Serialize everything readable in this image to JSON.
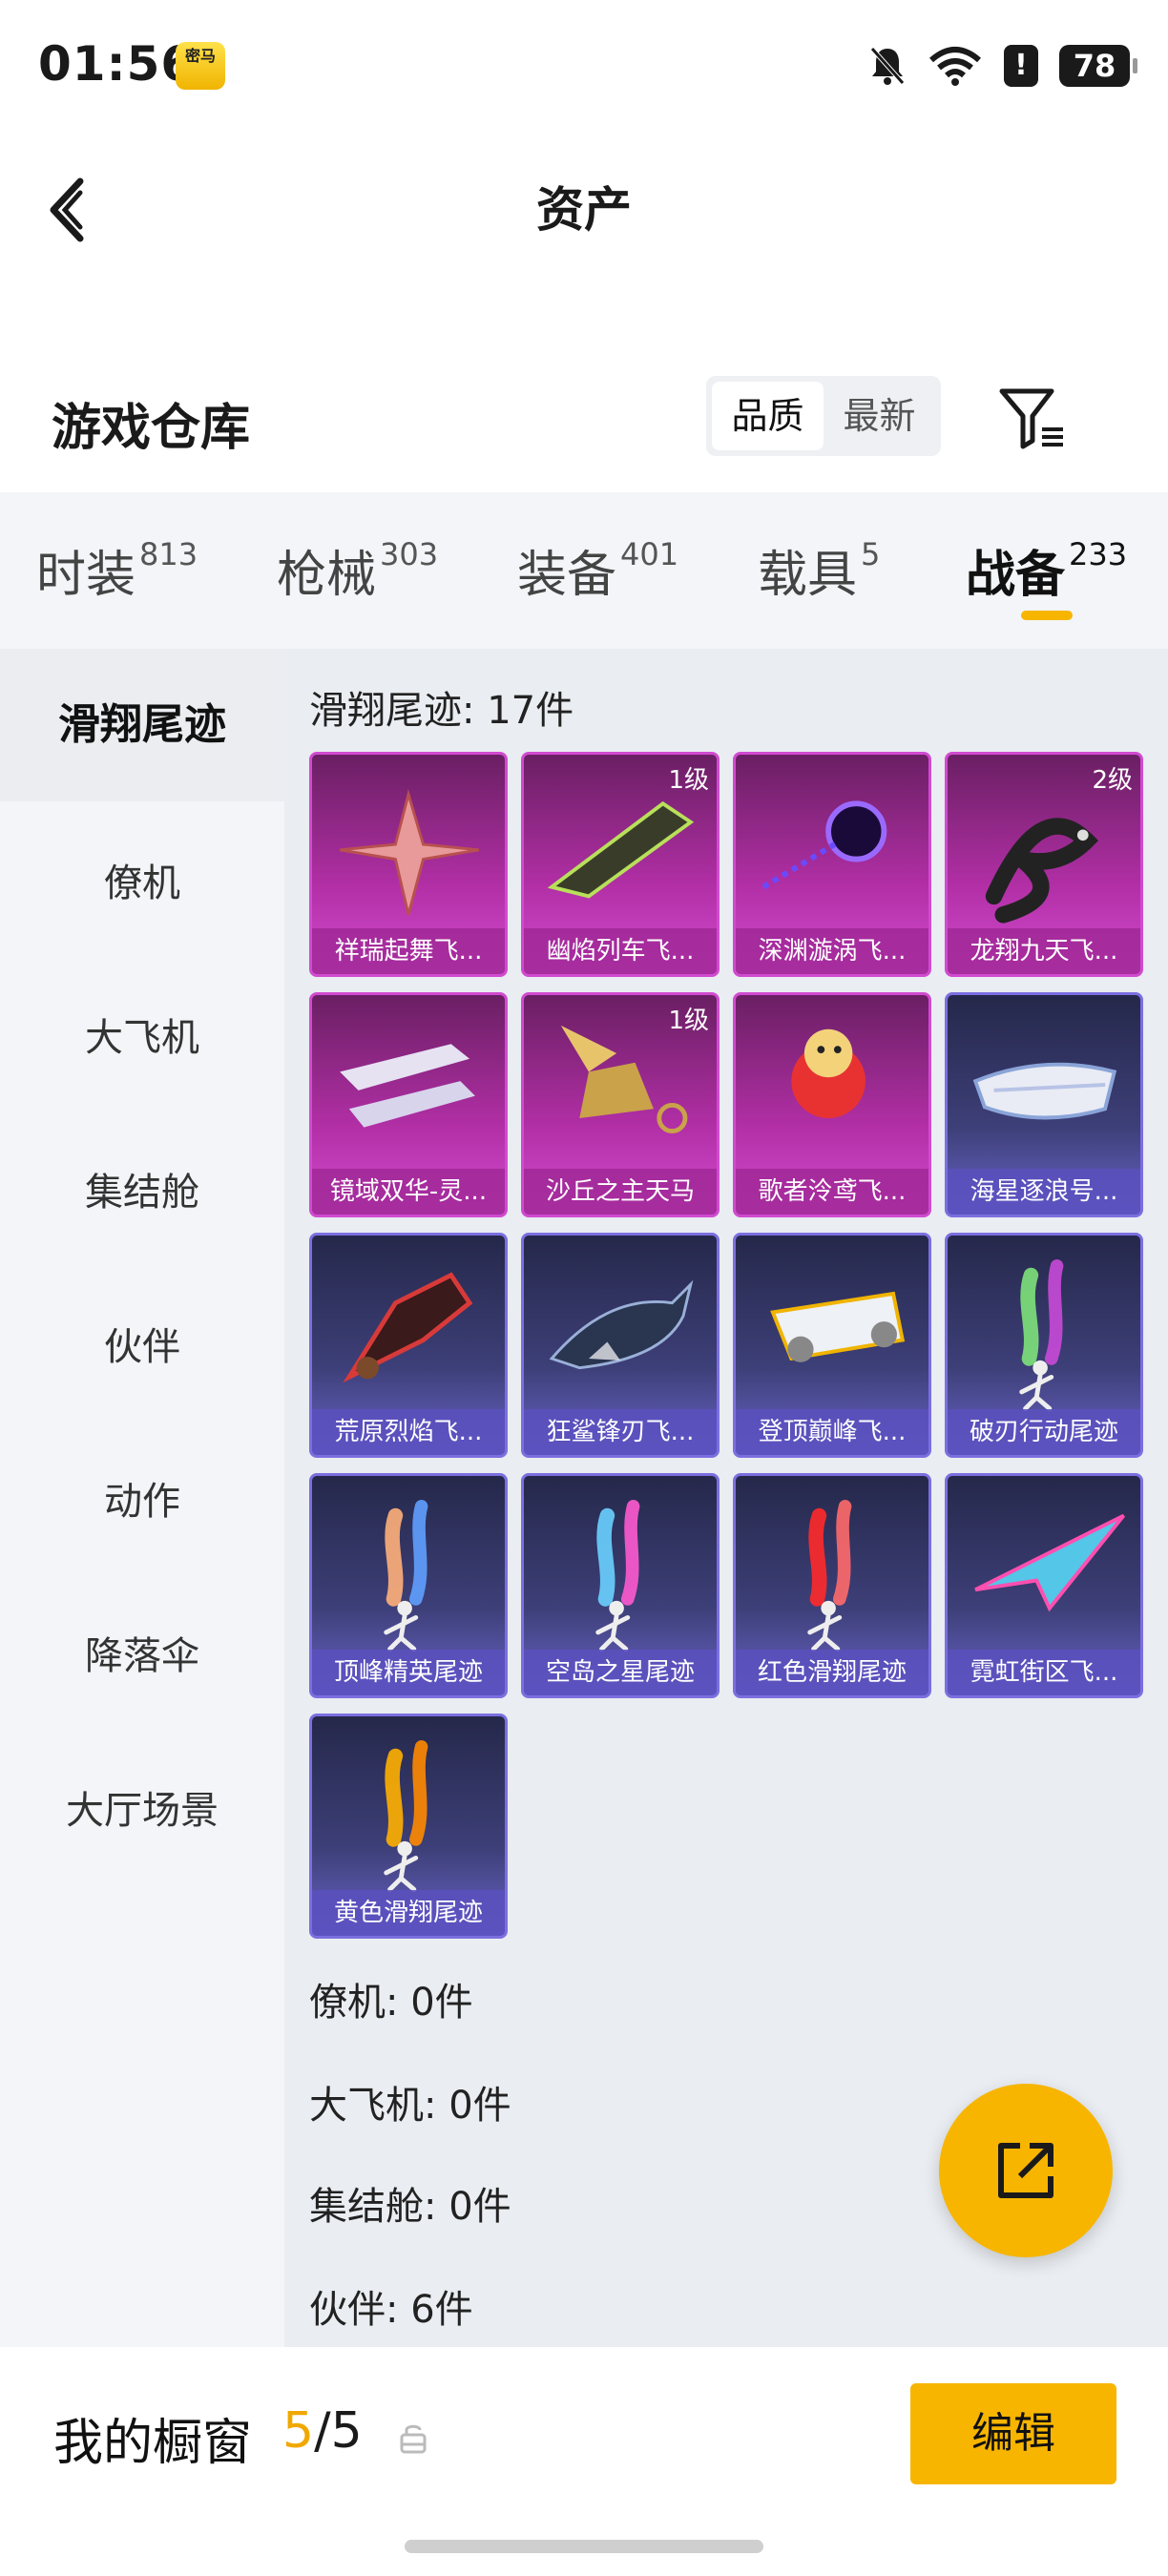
{
  "status_bar": {
    "time": "01:56",
    "app_badge": "密马",
    "alert": "!",
    "battery": "78"
  },
  "header": {
    "title": "资产"
  },
  "warehouse": {
    "title": "游戏仓库",
    "sort_options": [
      "品质",
      "最新"
    ],
    "active_sort": "品质"
  },
  "category_tabs": [
    {
      "label": "时装",
      "count": "813"
    },
    {
      "label": "枪械",
      "count": "303"
    },
    {
      "label": "装备",
      "count": "401"
    },
    {
      "label": "载具",
      "count": "5"
    },
    {
      "label": "战备",
      "count": "233"
    }
  ],
  "active_tab": "战备",
  "sidebar": {
    "items": [
      "滑翔尾迹",
      "僚机",
      "大飞机",
      "集结舱",
      "伙伴",
      "动作",
      "降落伞",
      "大厅场景"
    ],
    "active": "滑翔尾迹"
  },
  "sections": {
    "glide_trail": "滑翔尾迹: 17件",
    "wingman": "僚机: 0件",
    "big_plane": "大飞机: 0件",
    "assembly_pod": "集结舱: 0件",
    "partner": "伙伴: 6件"
  },
  "items": [
    {
      "name": "祥瑞起舞飞...",
      "level": "",
      "rarity": "purple",
      "icon": "petal-glider-icon"
    },
    {
      "name": "幽焰列车飞...",
      "level": "1级",
      "rarity": "purple",
      "icon": "train-glider-icon"
    },
    {
      "name": "深渊漩涡飞...",
      "level": "",
      "rarity": "purple",
      "icon": "vortex-glider-icon"
    },
    {
      "name": "龙翔九天飞...",
      "level": "2级",
      "rarity": "purple",
      "icon": "dragon-glider-icon"
    },
    {
      "name": "镜域双华-灵...",
      "level": "",
      "rarity": "purple",
      "icon": "crystal-glider-icon"
    },
    {
      "name": "沙丘之主天马",
      "level": "1级",
      "rarity": "purple",
      "icon": "pegasus-glider-icon"
    },
    {
      "name": "歌者泠鸢飞...",
      "level": "",
      "rarity": "purple",
      "icon": "bird-glider-icon"
    },
    {
      "name": "海星逐浪号...",
      "level": "",
      "rarity": "blue",
      "icon": "boat-glider-icon"
    },
    {
      "name": "荒原烈焰飞...",
      "level": "",
      "rarity": "blue",
      "icon": "flame-glider-icon"
    },
    {
      "name": "狂鲨锋刃飞...",
      "level": "",
      "rarity": "blue",
      "icon": "shark-glider-icon"
    },
    {
      "name": "登顶巅峰飞...",
      "level": "",
      "rarity": "blue",
      "icon": "jet-glider-icon"
    },
    {
      "name": "破刃行动尾迹",
      "level": "",
      "rarity": "blue",
      "icon": "trail-icon",
      "smoke": [
        "#7ee27a",
        "#c94ad8"
      ]
    },
    {
      "name": "顶峰精英尾迹",
      "level": "",
      "rarity": "blue",
      "icon": "trail-icon",
      "smoke": [
        "#ffb07a",
        "#5fa0ff"
      ]
    },
    {
      "name": "空岛之星尾迹",
      "level": "",
      "rarity": "blue",
      "icon": "trail-icon",
      "smoke": [
        "#6ad0ff",
        "#ff5ad0"
      ]
    },
    {
      "name": "红色滑翔尾迹",
      "level": "",
      "rarity": "blue",
      "icon": "trail-icon",
      "smoke": [
        "#ff2a2a",
        "#ff6a6a"
      ]
    },
    {
      "name": "霓虹街区飞...",
      "level": "",
      "rarity": "blue",
      "icon": "paper-plane-glider-icon"
    },
    {
      "name": "黄色滑翔尾迹",
      "level": "",
      "rarity": "blue",
      "icon": "trail-icon",
      "smoke": [
        "#ffb000",
        "#ff8a00"
      ]
    }
  ],
  "showcase": {
    "label": "我的橱窗",
    "current": "5",
    "separator_total": "/5",
    "edit_label": "编辑"
  },
  "colors": {
    "accent": "#f7b500",
    "purple_rarity": "#b22fa6",
    "blue_rarity": "#4a45a0"
  }
}
